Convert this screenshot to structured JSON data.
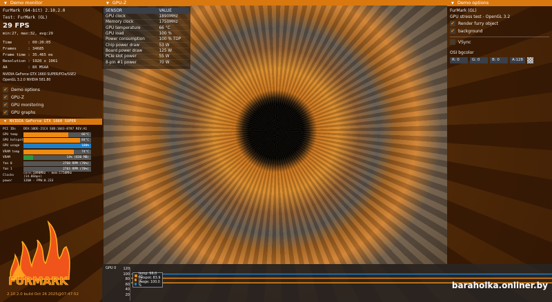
{
  "monitor": {
    "title": "Demo monitor",
    "app": "FurMark (64-bit) 2.10.2.0",
    "test": "Test: FurMark (GL)",
    "fps": "29 FPS",
    "fps_stats": "min:27, max:32, avg:29",
    "stats": [
      "Time       : 00:20:05",
      "Frames     : 34685",
      "Frame time : 35.465 ms",
      "Resolution : 1920 x 1061",
      "AA         : 8X MSAA"
    ],
    "gpu_info": "NVIDIA GeForce GTX 1660 SUPER/PCIe/SSE2",
    "gl_info": "OpenGL 3.2.0 NVIDIA 581.80",
    "checks": [
      {
        "label": "Demo options",
        "checked": true
      },
      {
        "label": "GPU-Z",
        "checked": true
      },
      {
        "label": "GPU monitoring",
        "checked": true
      },
      {
        "label": "GPU graphs",
        "checked": true
      }
    ]
  },
  "gpu_panel": {
    "title": "NVIDIA GeForce GTX 1660 SUPER",
    "pci_label": "PCI IDs",
    "pci_value": "DEV:10DE-21C4 SUB:1043-8787 REV:A1",
    "bars": [
      {
        "label": "GPU temp",
        "value": "66°C",
        "pct": 66,
        "color": "#f08a10"
      },
      {
        "label": "GPU hotspot",
        "value": "84°C",
        "pct": 84,
        "color": "#f08a10"
      },
      {
        "label": "GPU usage",
        "value": "100%",
        "pct": 100,
        "color": "#1e7fc8"
      },
      {
        "label": "VRAM temp",
        "value": "74°C",
        "pct": 74,
        "color": "#f08a10"
      },
      {
        "label": "VRAM",
        "value": "14% (830 MB)",
        "pct": 14,
        "color": "#2a9a40"
      },
      {
        "label": "fan 0",
        "value": "2760 RPM (70%)",
        "pct": 0,
        "color": "#888"
      },
      {
        "label": "fan 1",
        "value": "2783 RPM (70%)",
        "pct": 0,
        "color": "#888"
      }
    ],
    "clocks_label": "Clocks",
    "clocks_value": "core:1890MHz - mem:1750MHz (14.0Gbps)",
    "power_label": "power",
    "power_value": "126W - PPW:0.233"
  },
  "gpuz": {
    "title": "GPU-Z",
    "col_sensor": "SENSOR",
    "col_value": "VALUE",
    "rows": [
      [
        "GPU clock",
        "1890MHz"
      ],
      [
        "Memory clock",
        "1750MHz"
      ],
      [
        "GPU temperature",
        "66 °C"
      ],
      [
        "GPU load",
        "100 %"
      ],
      [
        "Power consumption",
        "100 % TDP"
      ],
      [
        "Chip power draw",
        "53 W"
      ],
      [
        "Board power draw",
        "125 W"
      ],
      [
        "PCIe slot power",
        "55 W"
      ],
      [
        "8-pin #1 power",
        "70 W"
      ]
    ]
  },
  "options": {
    "title": "Demo options",
    "name": "FurMark (GL)",
    "desc": "GPU stress test - OpenGL 3.2",
    "render_furry": "Render furry object",
    "background": "background",
    "vsync": "VSync",
    "osi_label": "OSI bgcolor",
    "r": "R: 0",
    "g": "G: 0",
    "b": "B: 0",
    "a": "A:128"
  },
  "graph": {
    "title": "GPU 0",
    "yticks": [
      "120",
      "100",
      "80",
      "60",
      "40",
      "20"
    ],
    "legend": [
      {
        "label": "temp: 66.0 °C",
        "color": "#f08a10"
      },
      {
        "label": "hotspot: 83.9 °C",
        "color": "#f08a10"
      },
      {
        "label": "usage: 100.0 %",
        "color": "#1e7fc8"
      }
    ],
    "series": {
      "temp": 66,
      "hotspot": 83.9,
      "usage": 100
    },
    "ylim": [
      0,
      120
    ]
  },
  "logo": {
    "text": "FURMARK",
    "build": "2.10.2.0 build Oct 26 2025@07:47:52"
  },
  "watermark": "baraholka.onliner.by"
}
